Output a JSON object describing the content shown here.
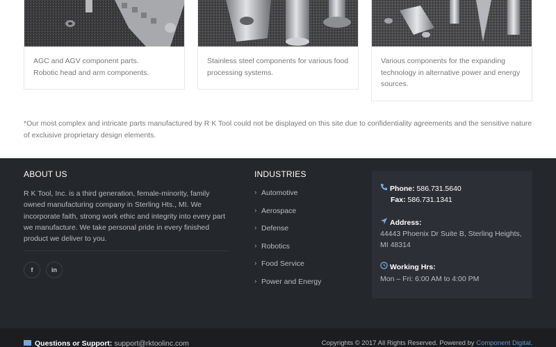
{
  "cards": [
    {
      "caption_lines": [
        "AGC and AGV component parts.",
        "Robotic head and arm components."
      ]
    },
    {
      "caption_lines": [
        "Stainless steel components for various food",
        "processing systems."
      ]
    },
    {
      "caption_lines": [
        "Various components for the expanding",
        "technology in alternative power and energy",
        "sources."
      ]
    }
  ],
  "note": "*Our most complex and intricate parts manufactured by R K Tool could not be displayed on this site due to confidentiality agreements and the sensitive nature of exclusive proprietary design elements.",
  "footer": {
    "about": {
      "heading": "ABOUT US",
      "text": "R K Tool, Inc. is a third generation, female-minority, family owned manufacturing company in Sterling Hts., MI. We incorporate faith, strong work ethic and integrity into every part we manufacture. We take personal pride in every finished product we deliver to you.",
      "social": {
        "facebook": "f",
        "linkedin": "in"
      }
    },
    "industries": {
      "heading": "INDUSTRIES",
      "items": [
        "Automotive",
        "Aerospace",
        "Defense",
        "Robotics",
        "Food Service",
        "Power and Energy"
      ]
    },
    "contact": {
      "phone_label": "Phone:",
      "phone": "586.731.5640",
      "fax_label": "Fax:",
      "fax": "586.731.1341",
      "address_label": "Address:",
      "address_line1": "44443 Phoenix Dr Suite B, Sterling Heights,",
      "address_line2": "MI 48314",
      "hours_label": "Working Hrs:",
      "hours": "Mon – Fri: 6:00 AM to 4:00 PM"
    }
  },
  "bottom": {
    "support_label": "Questions or Support:",
    "support_email": "support@rktoolinc.com",
    "copyright": "Copyrights © 2017 All Rights Reserved. Powered by",
    "powered_by": "Component Digital",
    "trailing": "."
  },
  "colors": {
    "footer_bg": "#24272c",
    "contact_bg": "#2c3036",
    "link_blue": "#5b9bd5",
    "icon_blue": "#7aa7d6"
  },
  "icons": {
    "phone": "phone-icon",
    "address": "location-arrow-icon",
    "hours": "clock-icon",
    "support": "envelope-icon",
    "industry_bullet": "chevron-right-icon"
  }
}
